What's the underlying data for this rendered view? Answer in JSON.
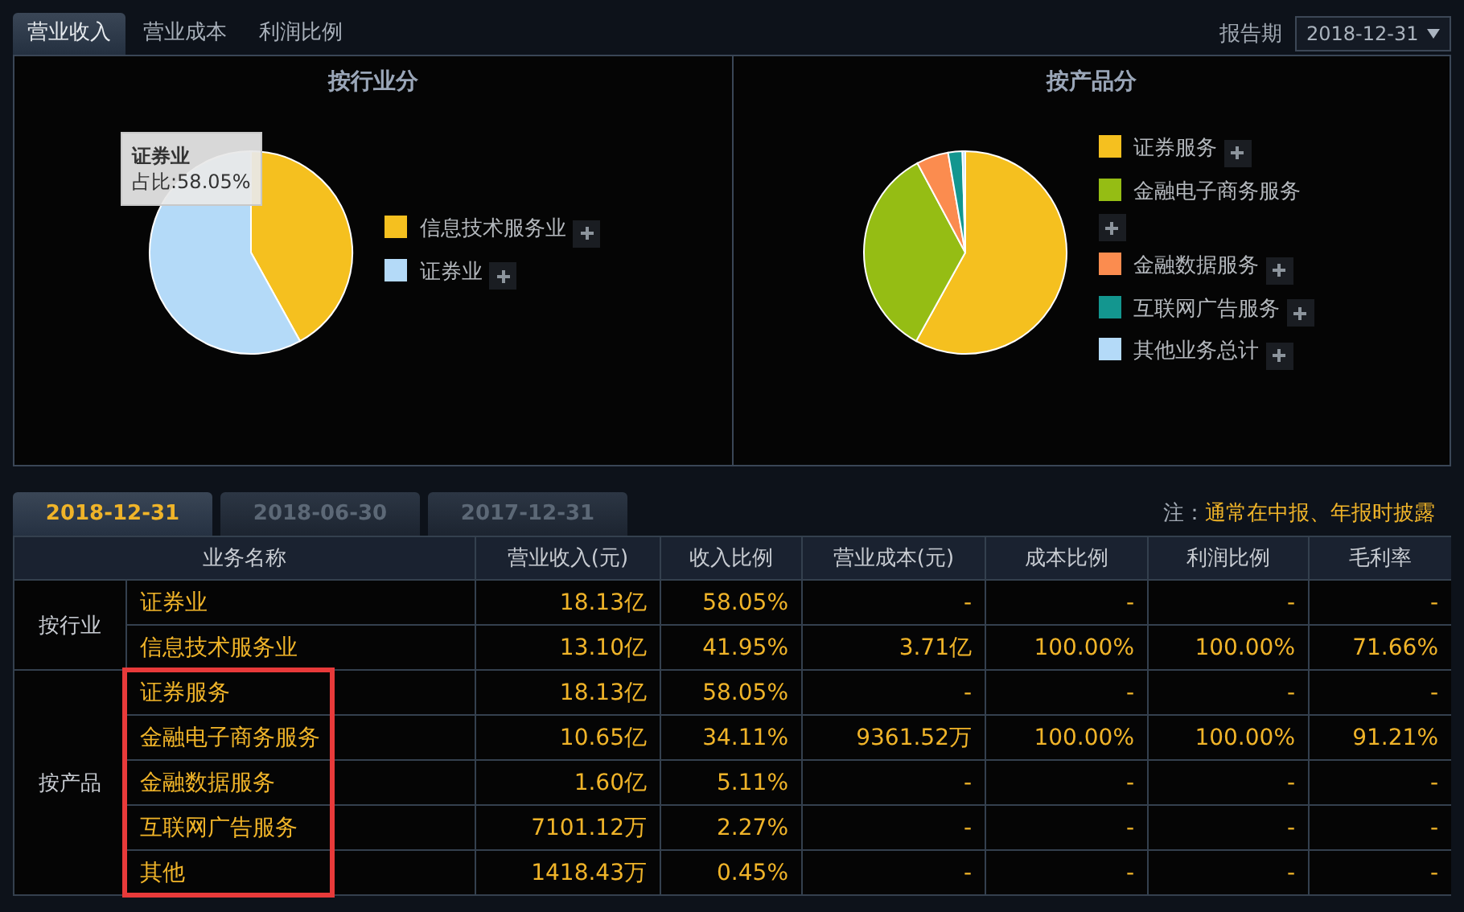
{
  "tabs": [
    {
      "label": "营业收入",
      "selected": true
    },
    {
      "label": "营业成本",
      "selected": false
    },
    {
      "label": "利润比例",
      "selected": false
    }
  ],
  "report_period": {
    "label": "报告期",
    "value": "2018-12-31"
  },
  "panels": [
    {
      "title": "按行业分",
      "legend": [
        {
          "color": "#f5c01f"
        },
        {
          "color": "#b4daf8"
        }
      ],
      "chart_data": {
        "type": "pie",
        "categories": [
          "信息技术服务业",
          "证券业"
        ],
        "values": [
          41.95,
          58.05
        ]
      },
      "tooltip": {
        "title": "证券业",
        "text": "占比:58.05%"
      }
    },
    {
      "title": "按产品分",
      "legend": [
        {
          "color": "#f5c01f"
        },
        {
          "color": "#95bd14"
        },
        {
          "color": "#fb8c4f"
        },
        {
          "color": "#13968f"
        },
        {
          "color": "#b4daf8"
        }
      ],
      "chart_data": {
        "type": "pie",
        "categories": [
          "证券服务",
          "金融电子商务服务",
          "金融数据服务",
          "互联网广告服务",
          "其他业务总计"
        ],
        "values": [
          58.05,
          34.11,
          5.11,
          2.27,
          0.45
        ]
      }
    }
  ],
  "period_tabs": [
    {
      "label": "2018-12-31",
      "selected": true
    },
    {
      "label": "2018-06-30",
      "selected": false
    },
    {
      "label": "2017-12-31",
      "selected": false
    }
  ],
  "note": {
    "label": "注：",
    "text": "通常在中报、年报时披露"
  },
  "table": {
    "columns": [
      "业务名称",
      "营业收入(元)",
      "收入比例",
      "营业成本(元)",
      "成本比例",
      "利润比例",
      "毛利率"
    ],
    "groups": [
      {
        "label": "按行业",
        "highlighted": false,
        "rows": [
          {
            "name": "证券业",
            "cells": [
              "18.13亿",
              "58.05%",
              "-",
              "-",
              "-",
              "-"
            ]
          },
          {
            "name": "信息技术服务业",
            "cells": [
              "13.10亿",
              "41.95%",
              "3.71亿",
              "100.00%",
              "100.00%",
              "71.66%"
            ]
          }
        ]
      },
      {
        "label": "按产品",
        "highlighted": true,
        "rows": [
          {
            "name": "证券服务",
            "cells": [
              "18.13亿",
              "58.05%",
              "-",
              "-",
              "-",
              "-"
            ]
          },
          {
            "name": "金融电子商务服务",
            "cells": [
              "10.65亿",
              "34.11%",
              "9361.52万",
              "100.00%",
              "100.00%",
              "91.21%"
            ]
          },
          {
            "name": "金融数据服务",
            "cells": [
              "1.60亿",
              "5.11%",
              "-",
              "-",
              "-",
              "-"
            ]
          },
          {
            "name": "互联网广告服务",
            "cells": [
              "7101.12万",
              "2.27%",
              "-",
              "-",
              "-",
              "-"
            ]
          },
          {
            "name": "其他",
            "cells": [
              "1418.43万",
              "0.45%",
              "-",
              "-",
              "-",
              "-"
            ]
          }
        ]
      }
    ]
  }
}
